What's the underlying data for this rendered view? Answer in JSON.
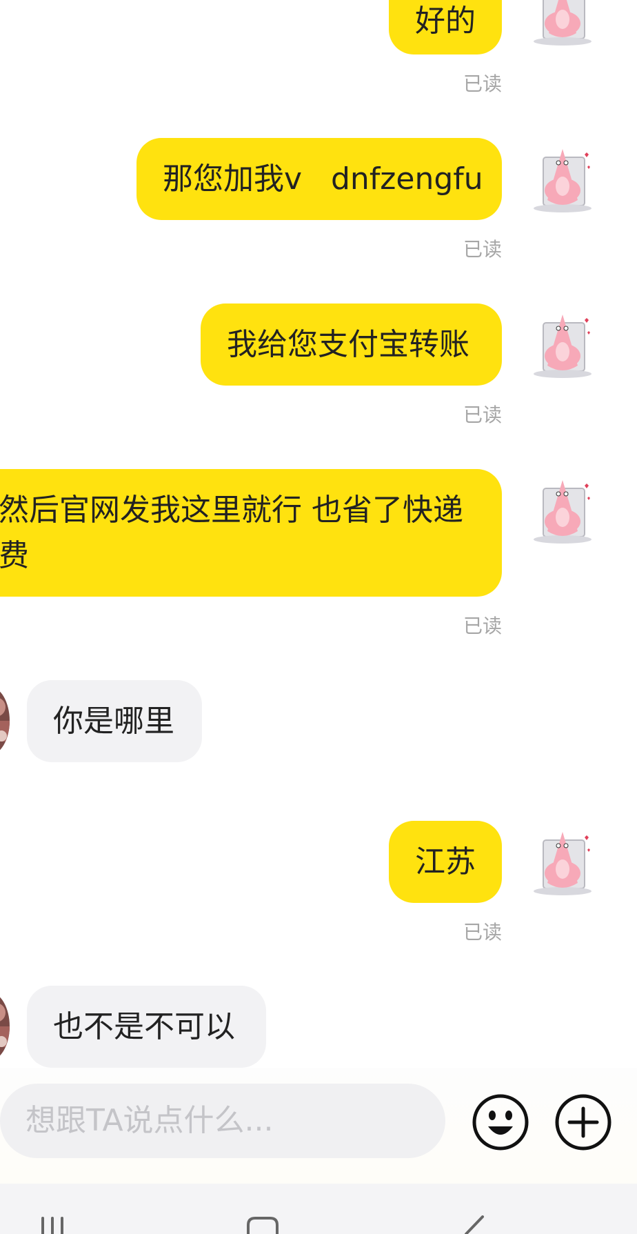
{
  "messages": [
    {
      "side": "me",
      "text": "好的",
      "status": "已读"
    },
    {
      "side": "me",
      "text": "那您加我v   dnfzengfu",
      "status": "已读"
    },
    {
      "side": "me",
      "text": "我给您支付宝转账",
      "status": "已读"
    },
    {
      "side": "me",
      "line1": "然后官网发我这里就行 也省了快递",
      "line2": "费",
      "status": "已读"
    },
    {
      "side": "other",
      "text": "你是哪里"
    },
    {
      "side": "me",
      "text": "江苏",
      "status": "已读"
    },
    {
      "side": "other",
      "text": "也不是不可以"
    }
  ],
  "input": {
    "placeholder": "想跟TA说点什么..."
  },
  "icons": {
    "emoji": "smiley-face-icon",
    "plus": "plus-circle-icon",
    "nav_recents": "recents-icon",
    "nav_home": "home-icon",
    "nav_back": "back-icon"
  },
  "colors": {
    "my_bubble": "#ffe20f",
    "other_bubble": "#f2f2f4",
    "read_status": "#a6a6a6"
  }
}
